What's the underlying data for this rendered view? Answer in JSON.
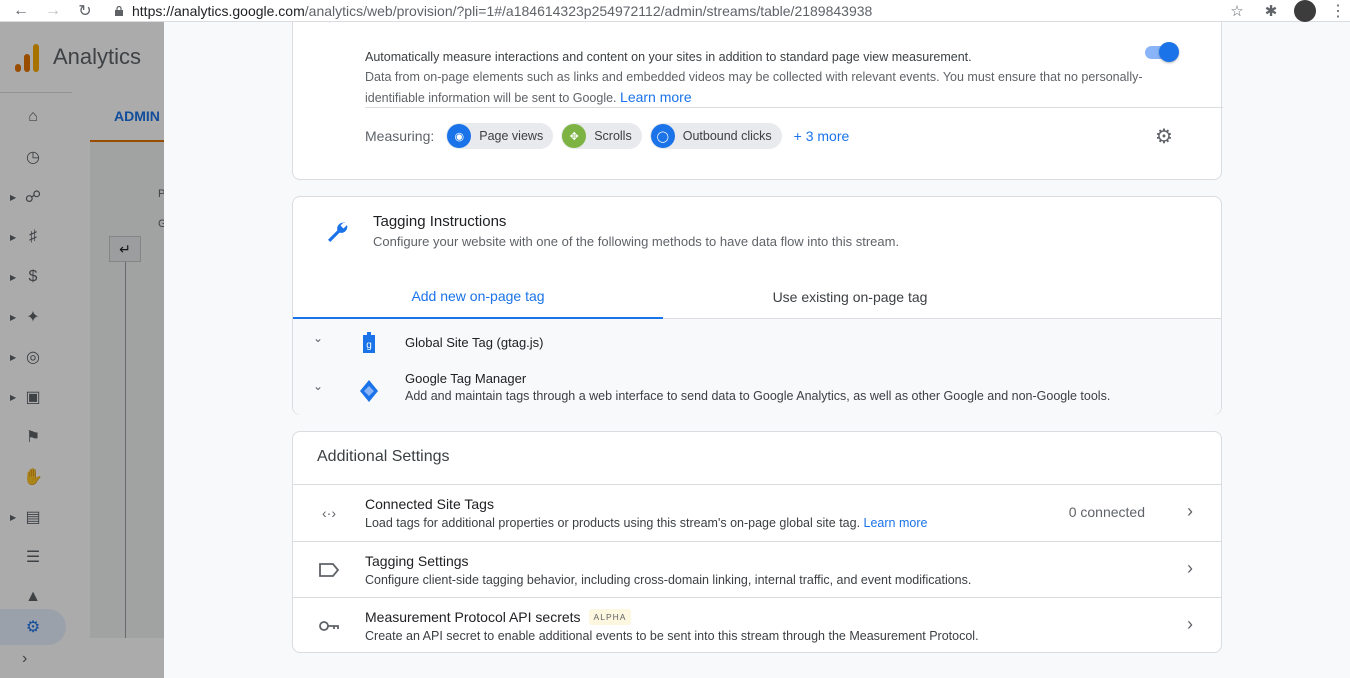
{
  "browser": {
    "url_domain": "https://analytics.google.com",
    "url_path": "/analytics/web/provision/?pli=1#/a184614323p254972112/admin/streams/table/2189843938",
    "icons": [
      "back-arrow-icon",
      "forward-arrow-icon",
      "reload-icon",
      "lock-icon",
      "star-icon",
      "extensions-icon",
      "avatar",
      "menu-icon"
    ]
  },
  "app": {
    "title": "Analytics",
    "admin_tab": "ADMIN",
    "admin_panel_labels": [
      "P",
      "G"
    ],
    "rail_icons": [
      "home-icon",
      "clock-icon",
      "share-icon",
      "tag-icon",
      "dollar-icon",
      "wand-icon",
      "globe-icon",
      "devices-icon",
      "flag-icon",
      "touch-icon",
      "report-icon",
      "list-icon",
      "shapes-icon",
      "settings-icon"
    ]
  },
  "enhanced_measurement": {
    "lead": "Automatically measure interactions and content on your sites in addition to standard page view measurement.",
    "body": "Data from on-page elements such as links and embedded videos may be collected with relevant events. You must ensure that no personally-identifiable information will be sent to Google.",
    "learn_more": "Learn more",
    "toggle_on": true,
    "measuring_label": "Measuring:",
    "chips": [
      {
        "label": "Page views",
        "color": "#1a73e8",
        "icon": "eye-icon"
      },
      {
        "label": "Scrolls",
        "color": "#7cb342",
        "icon": "scroll-icon"
      },
      {
        "label": "Outbound clicks",
        "color": "#1a73e8",
        "icon": "mouse-icon"
      }
    ],
    "more_link": "+ 3 more"
  },
  "tagging_instructions": {
    "title": "Tagging Instructions",
    "subtitle": "Configure your website with one of the following methods to have data flow into this stream.",
    "tabs": [
      "Add new on-page tag",
      "Use existing on-page tag"
    ],
    "accordion": [
      {
        "title": "Global Site Tag (gtag.js)",
        "desc": ""
      },
      {
        "title": "Google Tag Manager",
        "desc": "Add and maintain tags through a web interface to send data to Google Analytics, as well as other Google and non-Google tools."
      }
    ]
  },
  "additional_settings": {
    "title": "Additional Settings",
    "rows": [
      {
        "title": "Connected Site Tags",
        "desc": "Load tags for additional properties or products using this stream's on-page global site tag.",
        "link": "Learn more",
        "count": "0 connected"
      },
      {
        "title": "Tagging Settings",
        "desc": "Configure client-side tagging behavior, including cross-domain linking, internal traffic, and event modifications."
      },
      {
        "title": "Measurement Protocol API secrets",
        "badge": "ALPHA",
        "desc": "Create an API secret to enable additional events to be sent into this stream through the Measurement Protocol."
      }
    ]
  }
}
